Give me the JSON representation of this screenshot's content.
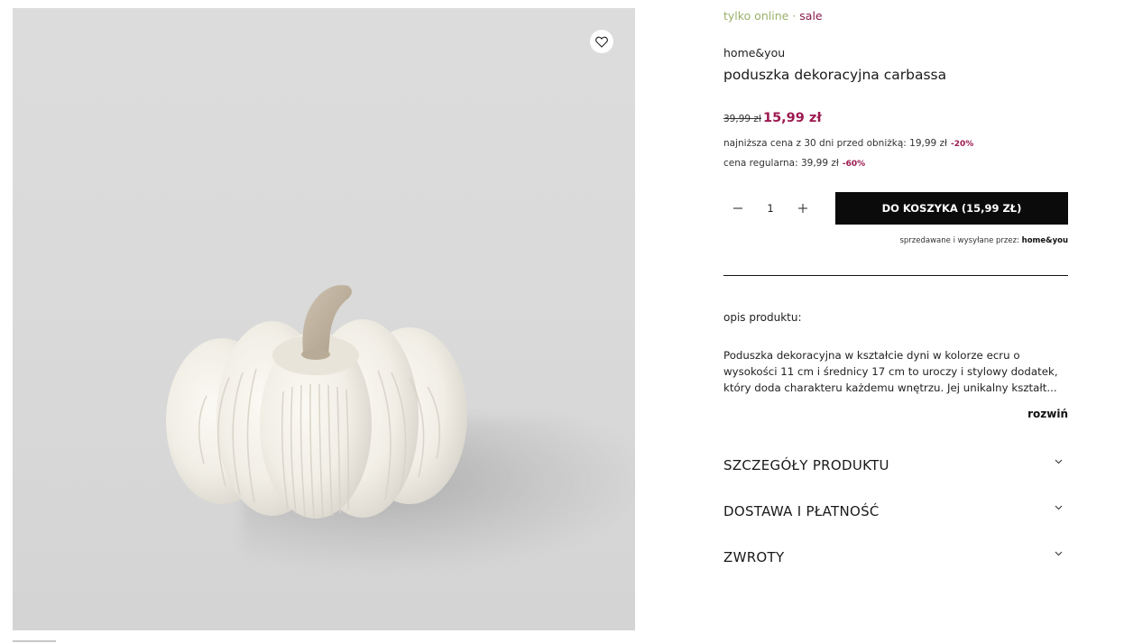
{
  "gallery": {
    "favorite_icon": "heart-icon",
    "image_subject": "pumpkin-cushion"
  },
  "product": {
    "tag_online": "tylko online",
    "tag_separator": "·",
    "tag_sale": "sale",
    "brand": "home&you",
    "title": "poduszka dekoracyjna carbassa"
  },
  "pricing": {
    "old_price": "39,99 zł",
    "new_price": "15,99 zł",
    "lowest_label": "najniższa cena z 30 dni przed obniżką: 19,99 zł",
    "lowest_discount": "-20%",
    "regular_label": "cena regularna: 39,99 zł",
    "regular_discount": "-60%",
    "accent_color": "#9c1a50"
  },
  "cart": {
    "quantity": "1",
    "minus_icon": "minus-icon",
    "plus_icon": "plus-icon",
    "add_label": "DO KOSZYKA  (15,99 ZŁ)",
    "seller_prefix": "sprzedawane i wysyłane przez:",
    "seller_name": "home&you"
  },
  "description": {
    "heading": "opis produktu:",
    "lines": [
      "Poduszka dekoracyjna w kształcie dyni w kolorze ecru o",
      "wysokości 11 cm i średnicy 17 cm to uroczy i stylowy dodatek,",
      "który doda charakteru każdemu wnętrzu. Jej unikalny kształt..."
    ],
    "expand_label": "rozwiń"
  },
  "accordion": [
    {
      "label": "SZCZEGÓŁY PRODUKTU",
      "icon": "chevron-down-icon"
    },
    {
      "label": "DOSTAWA I PŁATNOŚĆ",
      "icon": "chevron-down-icon"
    },
    {
      "label": "ZWROTY",
      "icon": "chevron-down-icon"
    }
  ]
}
